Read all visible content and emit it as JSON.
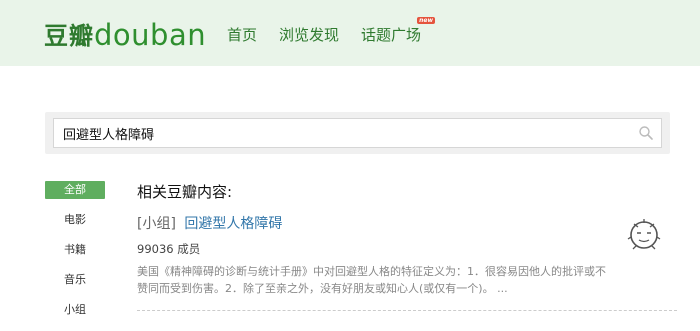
{
  "header": {
    "logo_cn": "豆瓣",
    "logo_en": "douban",
    "nav": [
      {
        "label": "首页"
      },
      {
        "label": "浏览发现"
      },
      {
        "label": "话题广场",
        "badge": "new"
      }
    ]
  },
  "search": {
    "value": "回避型人格障碍",
    "icon": "search-icon"
  },
  "sidebar": {
    "items": [
      {
        "label": "全部",
        "active": true
      },
      {
        "label": "电影"
      },
      {
        "label": "书籍"
      },
      {
        "label": "音乐"
      },
      {
        "label": "小组"
      }
    ]
  },
  "results": {
    "heading": "相关豆瓣内容:",
    "items": [
      {
        "type": "[小组]",
        "title": "回避型人格障碍",
        "meta": "99036 成员",
        "desc": "美国《精神障碍的诊断与统计手册》中对回避型人格的特征定义为：1．很容易因他人的批评或不赞同而受到伤害。2．除了至亲之外，没有好朋友或知心人(或仅有一个)。 ..."
      }
    ]
  },
  "colors": {
    "header_bg": "#e9f4e9",
    "brand_green": "#2f7a2f",
    "active_tab": "#5fae5f",
    "link": "#3377aa"
  }
}
